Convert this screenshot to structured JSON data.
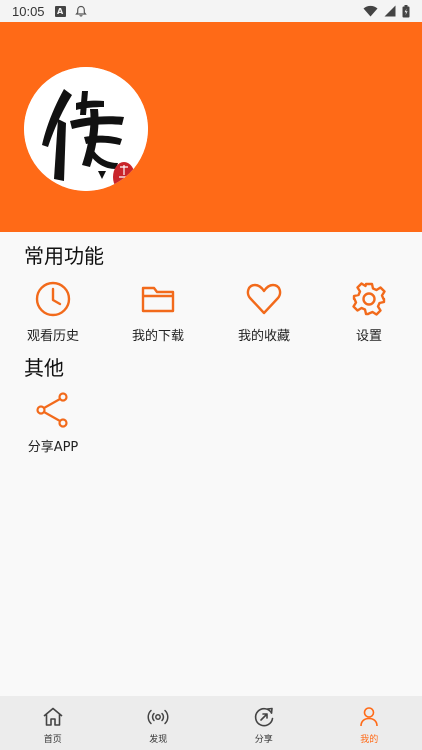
{
  "status_bar": {
    "time": "10:05",
    "notification_icons": [
      "a-icon",
      "alarm-off-icon"
    ],
    "right_icons": [
      "wifi-icon",
      "signal-icon",
      "battery-icon"
    ]
  },
  "colors": {
    "accent": "#ff6a17",
    "icon_stroke": "#f26a1b",
    "nav_inactive": "#444444"
  },
  "header": {
    "avatar_icon": "logo-calligraphy-icon"
  },
  "sections": {
    "common": {
      "title": "常用功能",
      "items": [
        {
          "label": "观看历史",
          "icon": "clock-icon"
        },
        {
          "label": "我的下载",
          "icon": "folder-icon"
        },
        {
          "label": "我的收藏",
          "icon": "heart-icon"
        },
        {
          "label": "设置",
          "icon": "gear-icon"
        }
      ]
    },
    "other": {
      "title": "其他",
      "items": [
        {
          "label": "分享APP",
          "icon": "share-icon"
        }
      ]
    }
  },
  "bottom_nav": {
    "items": [
      {
        "label": "首页",
        "icon": "home-icon",
        "active": false
      },
      {
        "label": "发现",
        "icon": "broadcast-icon",
        "active": false
      },
      {
        "label": "分享",
        "icon": "refresh-share-icon",
        "active": false
      },
      {
        "label": "我的",
        "icon": "person-icon",
        "active": true
      }
    ]
  }
}
